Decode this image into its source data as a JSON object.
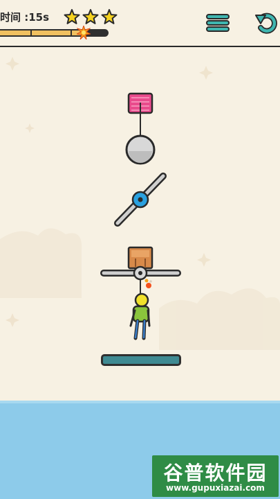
{
  "hud": {
    "timer_label": "时间 :15s",
    "stars_earned": 3,
    "stars_total": 3,
    "fuse_progress": 0.78,
    "menu_icon": "hamburger-menu-icon",
    "restart_icon": "restart-arrow-icon"
  },
  "scene": {
    "objects": [
      "pink-anchor-block",
      "grey-ball",
      "rotating-blade",
      "wooden-crate",
      "rotating-bar",
      "lit-bomb-fuse",
      "stickman-player",
      "landing-platform"
    ]
  },
  "colors": {
    "background": "#f7f1e3",
    "water": "#8dcbea",
    "platform": "#3f8a92",
    "pink_block": "#e94b8c",
    "blade_hub": "#2aa1e0",
    "star": "#f5d21f",
    "watermark_bg": "#2f8c46"
  },
  "watermark": {
    "title": "谷普软件园",
    "url": "www.gupuxiazai.com"
  }
}
